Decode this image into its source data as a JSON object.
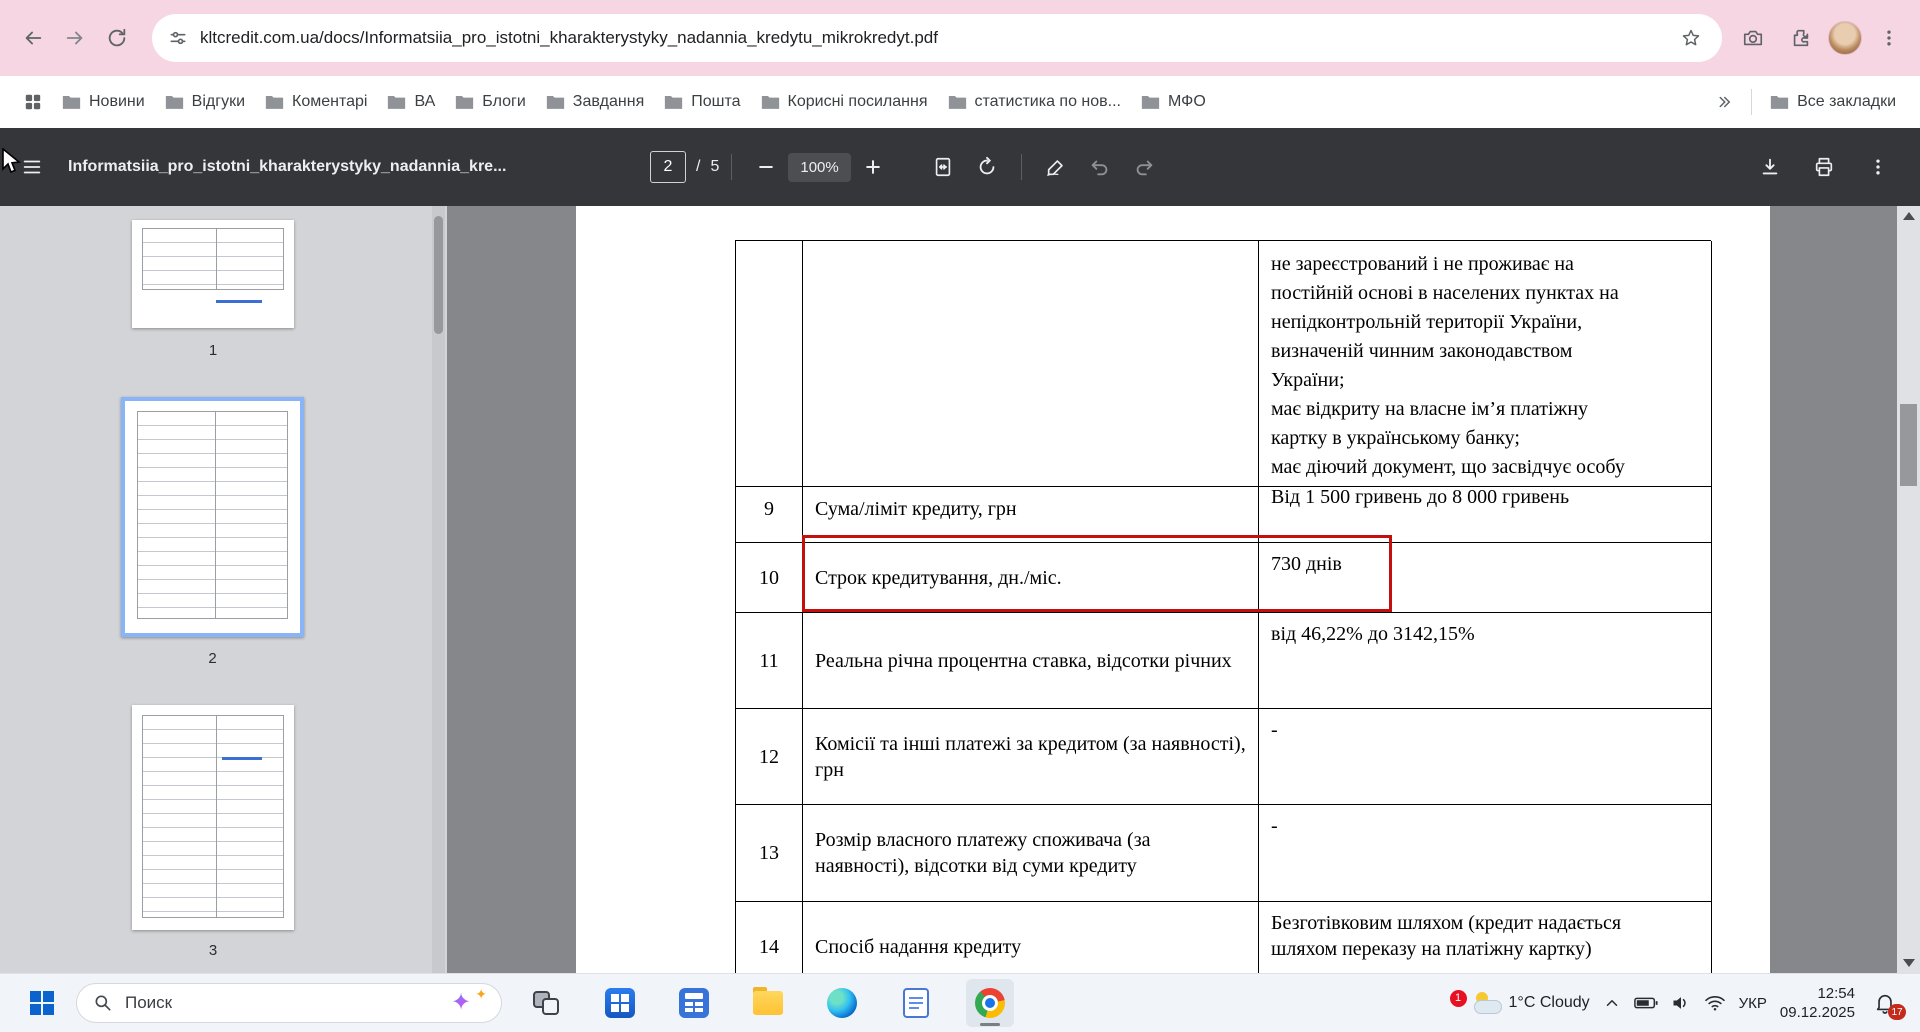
{
  "browser": {
    "url": "kltcredit.com.ua/docs/Informatsiia_pro_istotni_kharakterystyky_nadannia_kredytu_mikrokredyt.pdf",
    "bookmarks": [
      "Новини",
      "Відгуки",
      "Коментарі",
      "ВА",
      "Блоги",
      "Завдання",
      "Пошта",
      "Корисні посилання",
      "статистика по нов...",
      "МФО"
    ],
    "all_bookmarks_label": "Все закладки"
  },
  "pdf_toolbar": {
    "title": "Informatsiia_pro_istotni_kharakterystyky_nadannia_kre...",
    "current_page": "2",
    "page_separator": "/",
    "page_count": "5",
    "zoom_level": "100%"
  },
  "sidebar": {
    "thumbnails": [
      {
        "page": "1"
      },
      {
        "page": "2"
      },
      {
        "page": "3"
      }
    ]
  },
  "document": {
    "continuation_text": "не зареєстрований і не проживає на\nпостійній основі в населених пунктах на\nнепідконтрольній території України,\nвизначеній чинним законодавством\nУкраїни;\nмає відкриту на власне ім’я платіжну\nкартку в українському банку;\nмає діючий документ, що засвідчує особу",
    "rows": [
      {
        "num": "9",
        "label": "Сума/ліміт кредиту, грн",
        "value": "Від 1 500 гривень до 8 000 гривень"
      },
      {
        "num": "10",
        "label": "Строк кредитування, дн./міс.",
        "value": "730 днів"
      },
      {
        "num": "11",
        "label": "Реальна річна процентна ставка, відсотки річних",
        "value": "від 46,22% до 3142,15%"
      },
      {
        "num": "12",
        "label": "Комісії та інші платежі за кредитом (за наявності), грн",
        "value": "-"
      },
      {
        "num": "13",
        "label": "Розмір власного платежу споживача (за наявності), відсотки від суми кредиту",
        "value": "-"
      },
      {
        "num": "14",
        "label": "Спосіб надання кредиту",
        "value": "Безготівковим шляхом (кредит надається\nшляхом переказу на платіжну картку)"
      }
    ],
    "highlight_color": "#c40f0f"
  },
  "taskbar": {
    "search_label": "Поиск",
    "weather_badge": "1",
    "weather_text": "1°C Cloudy",
    "language": "УКР",
    "time": "12:54",
    "date": "09.12.2025",
    "notification_count": "17"
  }
}
